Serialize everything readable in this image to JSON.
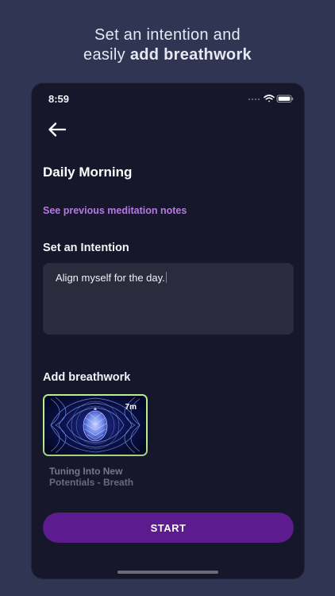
{
  "marketing": {
    "line1": "Set an intention and",
    "line2_prefix": "easily ",
    "line2_bold": "add breathwork"
  },
  "status_bar": {
    "time": "8:59",
    "icons": [
      "signal-icon",
      "wifi-icon",
      "battery-icon"
    ]
  },
  "nav": {
    "back_icon": "back-arrow-icon"
  },
  "page": {
    "title": "Daily Morning",
    "notes_link": "See previous meditation notes"
  },
  "intention": {
    "label": "Set an Intention",
    "value": "Align myself for the day."
  },
  "breathwork": {
    "label": "Add breathwork",
    "selected": {
      "duration": "7m",
      "title": "Tuning Into New Potentials - Breath",
      "icon": "pinecone-mandala-image"
    }
  },
  "actions": {
    "start_label": "START"
  },
  "colors": {
    "background": "#2f3553",
    "phone": "#16172a",
    "accent_link": "#b57ae3",
    "button": "#5c1c8f",
    "selected_border": "#b7ef8c",
    "input_bg": "#2a2b3d"
  }
}
